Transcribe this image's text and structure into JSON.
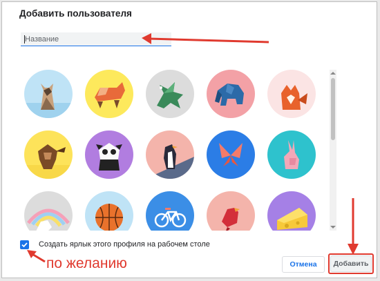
{
  "dialog": {
    "title": "Добавить пользователя",
    "name_input": {
      "placeholder": "Название",
      "value": ""
    },
    "avatars": [
      {
        "icon": "cat-icon",
        "bg": "#bfe3f6"
      },
      {
        "icon": "corgi-icon",
        "bg": "#fde95c"
      },
      {
        "icon": "dragon-icon",
        "bg": "#dcdcdc"
      },
      {
        "icon": "elephant-icon",
        "bg": "#f3a1a6"
      },
      {
        "icon": "fox-icon",
        "bg": "#fbe4e4"
      },
      {
        "icon": "monkey-icon",
        "bg": "#fde35a"
      },
      {
        "icon": "panda-icon",
        "bg": "#b17de0"
      },
      {
        "icon": "penguin-icon",
        "bg": "#f4b4ab"
      },
      {
        "icon": "butterfly-icon",
        "bg": "#2b7de6"
      },
      {
        "icon": "rabbit-icon",
        "bg": "#2ec2cd"
      },
      {
        "icon": "unicorn-icon",
        "bg": "#dcdcdc"
      },
      {
        "icon": "basketball-icon",
        "bg": "#bfe3f6"
      },
      {
        "icon": "bicycle-icon",
        "bg": "#3b8ee6"
      },
      {
        "icon": "bird-icon",
        "bg": "#f4b4ab"
      },
      {
        "icon": "cheese-icon",
        "bg": "#a580e6"
      }
    ],
    "shortcut_checkbox": {
      "checked": true,
      "label": "Создать ярлык этого профиля на рабочем столе"
    },
    "cancel_label": "Отмена",
    "add_label": "Добавить"
  },
  "annotation": {
    "text": "по желанию",
    "color": "#e03a2f"
  }
}
